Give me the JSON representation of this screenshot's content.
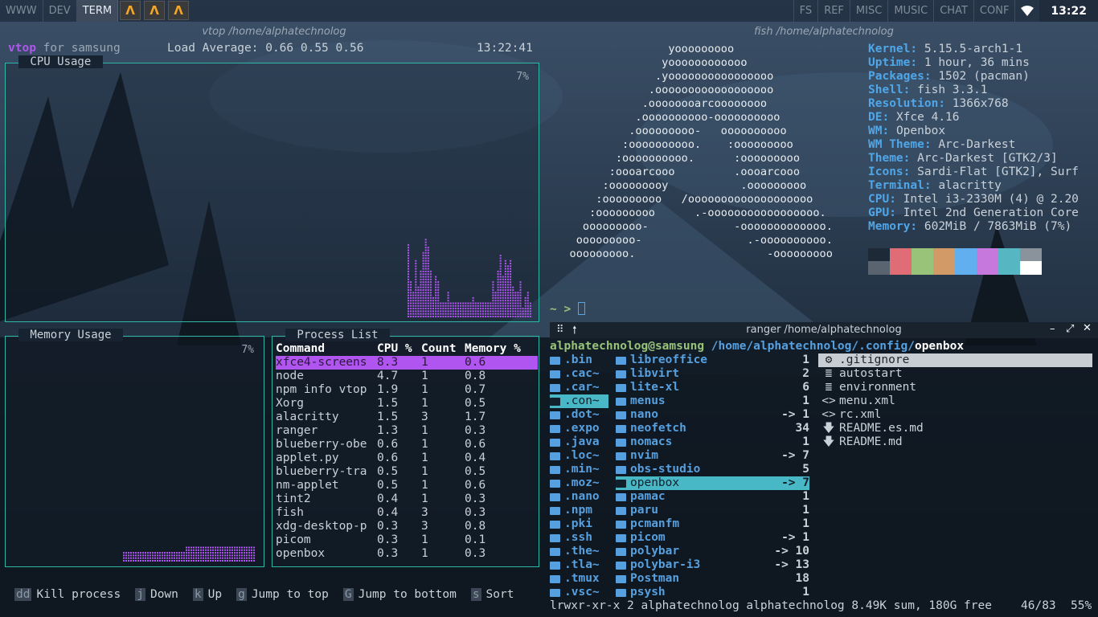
{
  "topbar": {
    "workspaces_left": [
      "WWW",
      "DEV",
      "TERM"
    ],
    "active_workspace": "TERM",
    "app_icons": [
      "alacritty-icon",
      "alacritty-icon",
      "alacritty-icon"
    ],
    "workspaces_right": [
      "FS",
      "REF",
      "MISC",
      "MUSIC",
      "CHAT",
      "CONF"
    ],
    "clock": "13:22"
  },
  "vtop": {
    "window_title": "vtop /home/alphatechnolog",
    "app_name": "vtop",
    "host_text": " for samsung",
    "load_label": "Load Average: 0.66 0.55 0.56",
    "time": "13:22:41",
    "cpu_label": " CPU Usage ",
    "cpu_percent": "7%",
    "memory_label": " Memory Usage ",
    "memory_percent": "7%",
    "process_label": " Process List ",
    "process_headers": [
      "Command",
      "CPU %",
      "Count",
      "Memory %"
    ],
    "processes": [
      [
        "xfce4-screens",
        "8.3",
        "1",
        "0.6"
      ],
      [
        "node",
        "4.7",
        "1",
        "0.8"
      ],
      [
        "npm info vtop",
        "1.9",
        "1",
        "0.7"
      ],
      [
        "Xorg",
        "1.5",
        "1",
        "0.5"
      ],
      [
        "alacritty",
        "1.5",
        "3",
        "1.7"
      ],
      [
        "ranger",
        "1.3",
        "1",
        "0.3"
      ],
      [
        "blueberry-obe",
        "0.6",
        "1",
        "0.6"
      ],
      [
        "applet.py",
        "0.6",
        "1",
        "0.4"
      ],
      [
        "blueberry-tra",
        "0.5",
        "1",
        "0.5"
      ],
      [
        "nm-applet",
        "0.5",
        "1",
        "0.6"
      ],
      [
        "tint2",
        "0.4",
        "1",
        "0.3"
      ],
      [
        "fish",
        "0.4",
        "3",
        "0.3"
      ],
      [
        "xdg-desktop-p",
        "0.3",
        "3",
        "0.8"
      ],
      [
        "picom",
        "0.3",
        "1",
        "0.1"
      ],
      [
        "openbox",
        "0.3",
        "1",
        "0.3"
      ]
    ],
    "shortcuts": [
      {
        "key": "dd",
        "label": "Kill process"
      },
      {
        "key": "j",
        "label": "Down"
      },
      {
        "key": "k",
        "label": "Up"
      },
      {
        "key": "g",
        "label": "Jump to top"
      },
      {
        "key": "G",
        "label": "Jump to bottom"
      },
      {
        "key": "s",
        "label": "Sort"
      }
    ],
    "colors": {
      "border": "#2fb7a6",
      "graph": "#b055f0",
      "selection": "#b055f0"
    }
  },
  "fish": {
    "window_title": "fish /home/alphatechnolog",
    "logo_lines": [
      "                  yooooooooo",
      "                 yoooooooooooo",
      "                .yoooooooooooooooo",
      "               .oooooooooooooooooo",
      "              .oooooooarcoooooooo",
      "             .oooooooooo-oooooooooo",
      "            .ooooooooo-   oooooooooo",
      "           :oooooooooo.    :ooooooooo",
      "          :oooooooooo.      :ooooooooo",
      "         :oooarcooo         .oooarcooo",
      "        :ooooooooy           .ooooooooo",
      "       :ooooooooo   /ooooooooooooooooooo",
      "      :ooooooooo      .-ooooooooooooooooo.",
      "     ooooooooo-             -ooooooooooooo.",
      "    ooooooooo-                .-oooooooooo.",
      "   ooooooooo.                    -ooooooooo"
    ],
    "info": [
      {
        "key": "Kernel",
        "value": "5.15.5-arch1-1"
      },
      {
        "key": "Uptime",
        "value": "1 hour, 36 mins"
      },
      {
        "key": "Packages",
        "value": "1502 (pacman)"
      },
      {
        "key": "Shell",
        "value": "fish 3.3.1"
      },
      {
        "key": "Resolution",
        "value": "1366x768"
      },
      {
        "key": "DE",
        "value": "Xfce 4.16"
      },
      {
        "key": "WM",
        "value": "Openbox"
      },
      {
        "key": "WM Theme",
        "value": "Arc-Darkest"
      },
      {
        "key": "Theme",
        "value": "Arc-Darkest [GTK2/3]"
      },
      {
        "key": "Icons",
        "value": "Sardi-Flat [GTK2], Surf"
      },
      {
        "key": "Terminal",
        "value": "alacritty"
      },
      {
        "key": "CPU",
        "value": "Intel i3-2330M (4) @ 2.20"
      },
      {
        "key": "GPU",
        "value": "Intel 2nd Generation Core"
      },
      {
        "key": "Memory",
        "value": "602MiB / 7863MiB (7%)"
      }
    ],
    "palette_top": [
      "#1d2937",
      "#e06c75",
      "#98c379",
      "#d19a66",
      "#61afef",
      "#c678dd",
      "#56b6c2",
      "#8a929b"
    ],
    "palette_bottom": [
      "#5a6470",
      "#e06c75",
      "#98c379",
      "#d19a66",
      "#61afef",
      "#c678dd",
      "#56b6c2",
      "#ffffff"
    ],
    "prompt": "~ > "
  },
  "ranger": {
    "window_title": "ranger /home/alphatechnolog",
    "path_user": "alphatechnolog@samsung",
    "path_dir": " /home/alphatechnolog/.config/",
    "path_current": "openbox",
    "parent_items": [
      ".bin",
      ".cac~",
      ".car~",
      ".con~",
      ".dot~",
      ".expo",
      ".java",
      ".loc~",
      ".min~",
      ".moz~",
      ".nano",
      ".npm",
      ".pki",
      ".ssh",
      ".the~",
      ".tla~",
      ".tmux",
      ".vsc~"
    ],
    "parent_selected": ".con~",
    "middle_items": [
      {
        "name": "libreoffice",
        "count": "1"
      },
      {
        "name": "libvirt",
        "count": "2"
      },
      {
        "name": "lite-xl",
        "count": "6"
      },
      {
        "name": "menus",
        "count": "1"
      },
      {
        "name": "nano",
        "count": "-> 1"
      },
      {
        "name": "neofetch",
        "count": "34"
      },
      {
        "name": "nomacs",
        "count": "1"
      },
      {
        "name": "nvim",
        "count": "-> 7"
      },
      {
        "name": "obs-studio",
        "count": "5"
      },
      {
        "name": "openbox",
        "count": "-> 7"
      },
      {
        "name": "pamac",
        "count": "1"
      },
      {
        "name": "paru",
        "count": "1"
      },
      {
        "name": "pcmanfm",
        "count": "1"
      },
      {
        "name": "picom",
        "count": "-> 1"
      },
      {
        "name": "polybar",
        "count": "-> 10"
      },
      {
        "name": "polybar-i3",
        "count": "-> 13"
      },
      {
        "name": "Postman",
        "count": "18"
      },
      {
        "name": "psysh",
        "count": "1"
      }
    ],
    "middle_selected": "openbox",
    "preview_items": [
      {
        "icon": "⚙",
        "name": ".gitignore"
      },
      {
        "icon": "≣",
        "name": "autostart"
      },
      {
        "icon": "≣",
        "name": "environment"
      },
      {
        "icon": "<>",
        "name": "menu.xml"
      },
      {
        "icon": "<>",
        "name": "rc.xml"
      },
      {
        "icon": "🡇",
        "name": "README.es.md"
      },
      {
        "icon": "🡇",
        "name": "README.md"
      }
    ],
    "status_left": "lrwxr-xr-x 2 alphatechnolog alphatechnolog 8.49K sum, 180G free",
    "status_pos": "46/83",
    "status_pct": "55%"
  }
}
